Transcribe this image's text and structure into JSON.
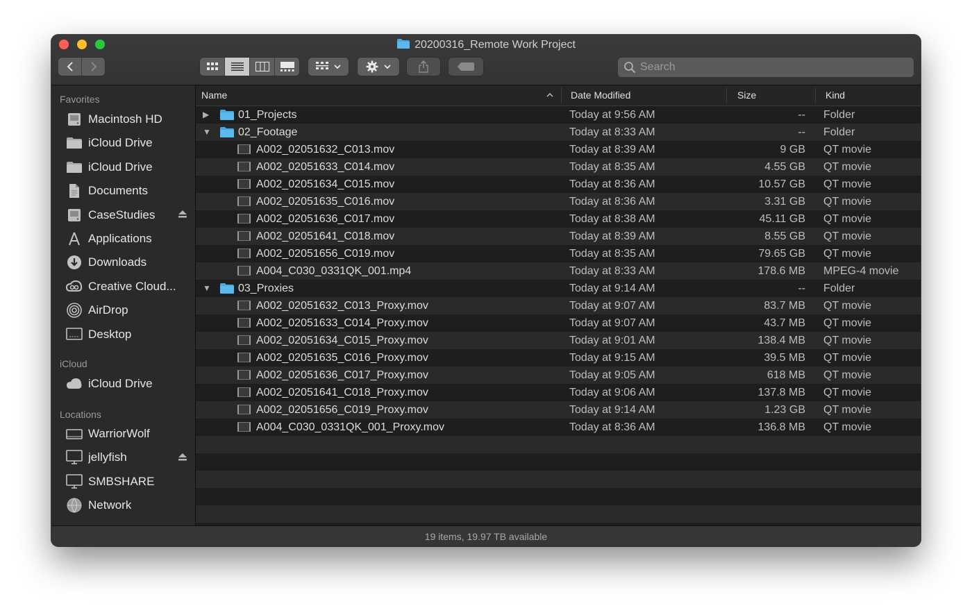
{
  "window": {
    "title": "20200316_Remote Work Project"
  },
  "toolbar": {
    "back_icon": "chevron-left-icon",
    "forward_icon": "chevron-right-icon",
    "view_modes": [
      "icon-view",
      "list-view",
      "column-view",
      "gallery-view"
    ],
    "active_view": "list-view",
    "search_placeholder": "Search"
  },
  "sidebar": {
    "favorites_title": "Favorites",
    "favorites": [
      {
        "label": "Macintosh HD",
        "icon": "harddrive-icon"
      },
      {
        "label": "iCloud Drive",
        "icon": "folder-icon"
      },
      {
        "label": "iCloud Drive",
        "icon": "folder-icon"
      },
      {
        "label": "Documents",
        "icon": "document-icon"
      },
      {
        "label": "CaseStudies",
        "icon": "harddrive-icon",
        "eject": true
      },
      {
        "label": "Applications",
        "icon": "applications-icon"
      },
      {
        "label": "Downloads",
        "icon": "download-icon"
      },
      {
        "label": "Creative Cloud...",
        "icon": "creative-cloud-icon"
      },
      {
        "label": "AirDrop",
        "icon": "airdrop-icon"
      },
      {
        "label": "Desktop",
        "icon": "desktop-icon"
      }
    ],
    "icloud_title": "iCloud",
    "icloud": [
      {
        "label": "iCloud Drive",
        "icon": "cloud-icon"
      }
    ],
    "locations_title": "Locations",
    "locations": [
      {
        "label": "WarriorWolf",
        "icon": "disk-icon"
      },
      {
        "label": "jellyfish",
        "icon": "monitor-icon",
        "eject": true
      },
      {
        "label": "SMBSHARE",
        "icon": "monitor-icon"
      },
      {
        "label": "Network",
        "icon": "network-icon"
      }
    ]
  },
  "columns": {
    "name": "Name",
    "date": "Date Modified",
    "size": "Size",
    "kind": "Kind"
  },
  "files": [
    {
      "name": "01_Projects",
      "date": "Today at 9:56 AM",
      "size": "--",
      "kind": "Folder",
      "type": "folder",
      "level": 0,
      "expanded": false
    },
    {
      "name": "02_Footage",
      "date": "Today at 8:33 AM",
      "size": "--",
      "kind": "Folder",
      "type": "folder",
      "level": 0,
      "expanded": true
    },
    {
      "name": "A002_02051632_C013.mov",
      "date": "Today at 8:39 AM",
      "size": "9 GB",
      "kind": "QT movie",
      "type": "movie",
      "level": 1
    },
    {
      "name": "A002_02051633_C014.mov",
      "date": "Today at 8:35 AM",
      "size": "4.55 GB",
      "kind": "QT movie",
      "type": "movie",
      "level": 1
    },
    {
      "name": "A002_02051634_C015.mov",
      "date": "Today at 8:36 AM",
      "size": "10.57 GB",
      "kind": "QT movie",
      "type": "movie",
      "level": 1
    },
    {
      "name": "A002_02051635_C016.mov",
      "date": "Today at 8:36 AM",
      "size": "3.31 GB",
      "kind": "QT movie",
      "type": "movie",
      "level": 1
    },
    {
      "name": "A002_02051636_C017.mov",
      "date": "Today at 8:38 AM",
      "size": "45.11 GB",
      "kind": "QT movie",
      "type": "movie",
      "level": 1
    },
    {
      "name": "A002_02051641_C018.mov",
      "date": "Today at 8:39 AM",
      "size": "8.55 GB",
      "kind": "QT movie",
      "type": "movie",
      "level": 1
    },
    {
      "name": "A002_02051656_C019.mov",
      "date": "Today at 8:35 AM",
      "size": "79.65 GB",
      "kind": "QT movie",
      "type": "movie",
      "level": 1
    },
    {
      "name": "A004_C030_0331QK_001.mp4",
      "date": "Today at 8:33 AM",
      "size": "178.6 MB",
      "kind": "MPEG-4 movie",
      "type": "movie",
      "level": 1
    },
    {
      "name": "03_Proxies",
      "date": "Today at 9:14 AM",
      "size": "--",
      "kind": "Folder",
      "type": "folder",
      "level": 0,
      "expanded": true
    },
    {
      "name": "A002_02051632_C013_Proxy.mov",
      "date": "Today at 9:07 AM",
      "size": "83.7 MB",
      "kind": "QT movie",
      "type": "movie",
      "level": 1
    },
    {
      "name": "A002_02051633_C014_Proxy.mov",
      "date": "Today at 9:07 AM",
      "size": "43.7 MB",
      "kind": "QT movie",
      "type": "movie",
      "level": 1
    },
    {
      "name": "A002_02051634_C015_Proxy.mov",
      "date": "Today at 9:01 AM",
      "size": "138.4 MB",
      "kind": "QT movie",
      "type": "movie",
      "level": 1
    },
    {
      "name": "A002_02051635_C016_Proxy.mov",
      "date": "Today at 9:15 AM",
      "size": "39.5 MB",
      "kind": "QT movie",
      "type": "movie",
      "level": 1
    },
    {
      "name": "A002_02051636_C017_Proxy.mov",
      "date": "Today at 9:05 AM",
      "size": "618 MB",
      "kind": "QT movie",
      "type": "movie",
      "level": 1
    },
    {
      "name": "A002_02051641_C018_Proxy.mov",
      "date": "Today at 9:06 AM",
      "size": "137.8 MB",
      "kind": "QT movie",
      "type": "movie",
      "level": 1
    },
    {
      "name": "A002_02051656_C019_Proxy.mov",
      "date": "Today at 9:14 AM",
      "size": "1.23 GB",
      "kind": "QT movie",
      "type": "movie",
      "level": 1
    },
    {
      "name": "A004_C030_0331QK_001_Proxy.mov",
      "date": "Today at 8:36 AM",
      "size": "136.8 MB",
      "kind": "QT movie",
      "type": "movie",
      "level": 1
    }
  ],
  "status": {
    "text": "19 items, 19.97 TB available"
  },
  "colors": {
    "folder": "#4aa8e0",
    "window_bg": "#1e1e1e",
    "sidebar_bg": "#2a2a2a",
    "stripe": "#2a2a2a"
  }
}
